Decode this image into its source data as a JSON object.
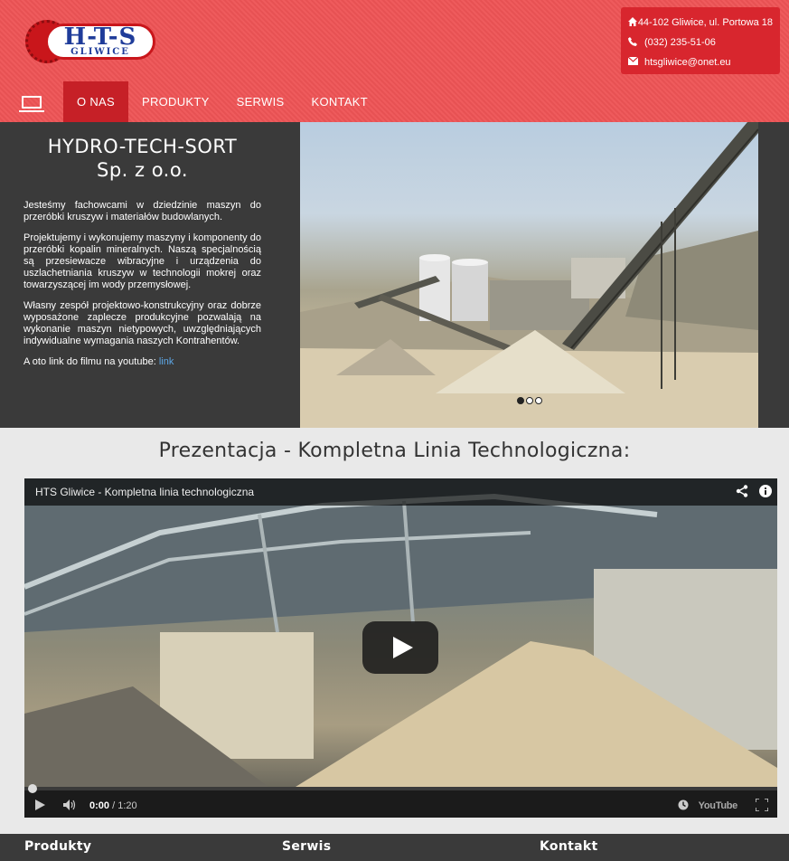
{
  "header": {
    "logo": {
      "text_main": "H-T-S",
      "text_sub": "GLIWICE"
    },
    "contact": {
      "address": "44-102 Gliwice, ul. Portowa 18",
      "phone": "(032) 235-51-06",
      "email": "htsgliwice@onet.eu"
    }
  },
  "nav": {
    "items": [
      {
        "label": "O NAS",
        "active": true
      },
      {
        "label": "PRODUKTY",
        "active": false
      },
      {
        "label": "SERWIS",
        "active": false
      },
      {
        "label": "KONTAKT",
        "active": false
      }
    ]
  },
  "about": {
    "title_line1": "HYDRO-TECH-SORT",
    "title_line2": "Sp. z o.o.",
    "p1": "Jesteśmy fachowcami w dziedzinie maszyn do przeróbki kruszyw i materiałów budowlanych.",
    "p2": "Projektujemy i wykonujemy maszyny i komponenty do przeróbki kopalin mineralnych. Naszą specjalnością są przesiewacze wibracyjne i urządzenia do uszlachetniania kruszyw w technologii mokrej oraz towarzyszącej im wody przemysłowej.",
    "p3": "Własny zespół projektowo-konstrukcyjny oraz dobrze wyposażone zaplecze produkcyjne pozwalają na wykonanie maszyn nietypowych, uwzględniających indywidualne wymagania naszych Kontrahentów.",
    "p4_prefix": "A oto link do filmu na youtube:",
    "p4_link": "link"
  },
  "slider": {
    "slide_count": 3,
    "active_index": 0
  },
  "section": {
    "title": "Prezentacja - Kompletna Linia Technologiczna:"
  },
  "video": {
    "title": "HTS Gliwice - Kompletna linia technologiczna",
    "current_time": "0:00",
    "duration": "1:20",
    "logo": "YouTube"
  },
  "footer": {
    "col1": "Produkty",
    "col2": "Serwis",
    "col3": "Kontakt"
  }
}
